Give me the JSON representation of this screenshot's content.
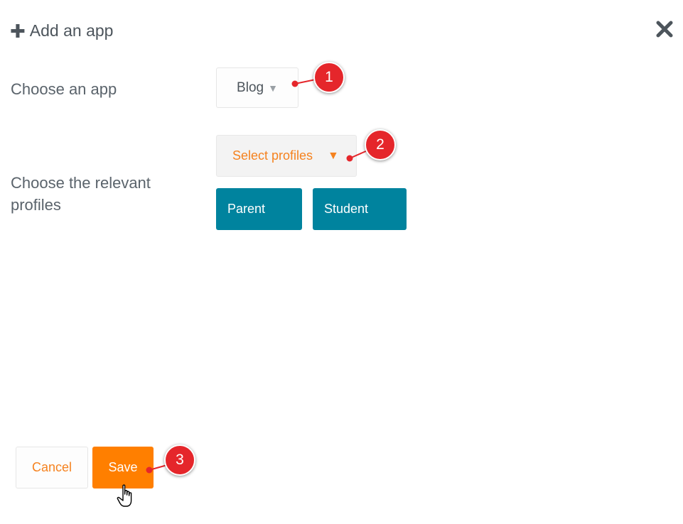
{
  "dialog": {
    "title": "Add an app",
    "title_icon": "plus-icon",
    "close_icon": "close-icon"
  },
  "form": {
    "app_label": "Choose an app",
    "app_value": "Blog",
    "profiles_label": "Choose the relevant profiles",
    "profiles_placeholder": "Select profiles",
    "selected_profiles": [
      "Parent",
      "Student"
    ]
  },
  "actions": {
    "cancel_label": "Cancel",
    "save_label": "Save"
  },
  "annotations": {
    "markers": [
      "1",
      "2",
      "3"
    ]
  },
  "colors": {
    "accent_orange": "#ff7f00",
    "link_orange": "#f5821f",
    "chip_teal": "#00839e",
    "marker_red": "#e5262b",
    "text_gray": "#4d555c"
  }
}
